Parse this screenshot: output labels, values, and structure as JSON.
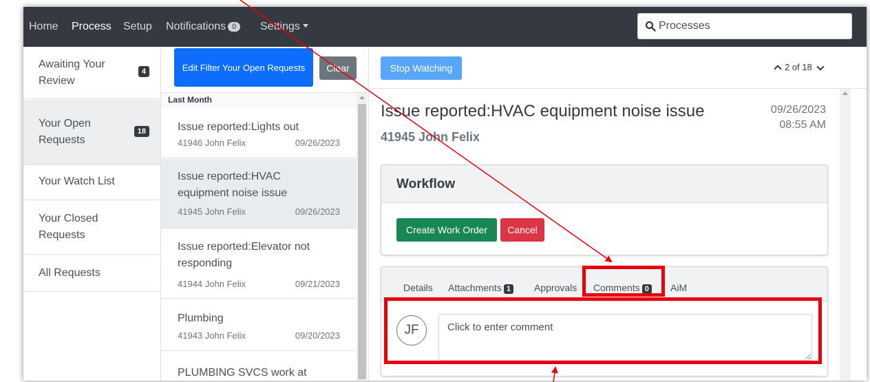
{
  "navbar": {
    "home": "Home",
    "process": "Process",
    "setup": "Setup",
    "notifications": "Notifications",
    "notifications_count": "0",
    "settings": "Settings",
    "search_placeholder": "Processes"
  },
  "sidebar": {
    "items": [
      {
        "label": "Awaiting Your Review",
        "badge": "4"
      },
      {
        "label": "Your Open Requests",
        "badge": "18"
      },
      {
        "label": "Your Watch List"
      },
      {
        "label": "Your Closed Requests"
      },
      {
        "label": "All Requests"
      }
    ]
  },
  "list": {
    "filter_button": "Edit Filter Your Open Requests",
    "clear_button": "Clear",
    "group_header": "Last Month",
    "items": [
      {
        "title": "Issue reported:Lights out",
        "meta": "41946 John Felix",
        "date": "09/26/2023"
      },
      {
        "title": "Issue reported:HVAC equipment noise issue",
        "meta": "41945 John Felix",
        "date": "09/26/2023"
      },
      {
        "title": "Issue reported:Elevator not responding",
        "meta": "41944 John Felix",
        "date": "09/21/2023"
      },
      {
        "title": "Plumbing",
        "meta": "41943 John Felix",
        "date": "09/20/2023"
      },
      {
        "title": "PLUMBING SVCS work at"
      }
    ]
  },
  "detail": {
    "stop_watching": "Stop Watching",
    "pager": "2 of 18",
    "title": "Issue reported:HVAC equipment noise issue",
    "subtitle": "41945 John Felix",
    "date": "09/26/2023",
    "time": "08:55 AM",
    "workflow": {
      "heading": "Workflow",
      "create_button": "Create Work Order",
      "cancel_button": "Cancel"
    },
    "tabs": [
      {
        "label": "Details"
      },
      {
        "label": "Attachments",
        "badge": "1"
      },
      {
        "label": "Approvals"
      },
      {
        "label": "Comments",
        "badge": "0"
      },
      {
        "label": "AiM"
      }
    ],
    "avatar_initials": "JF",
    "comment_placeholder": "Click to enter comment"
  },
  "annotation": {
    "color": "#e8000b"
  }
}
